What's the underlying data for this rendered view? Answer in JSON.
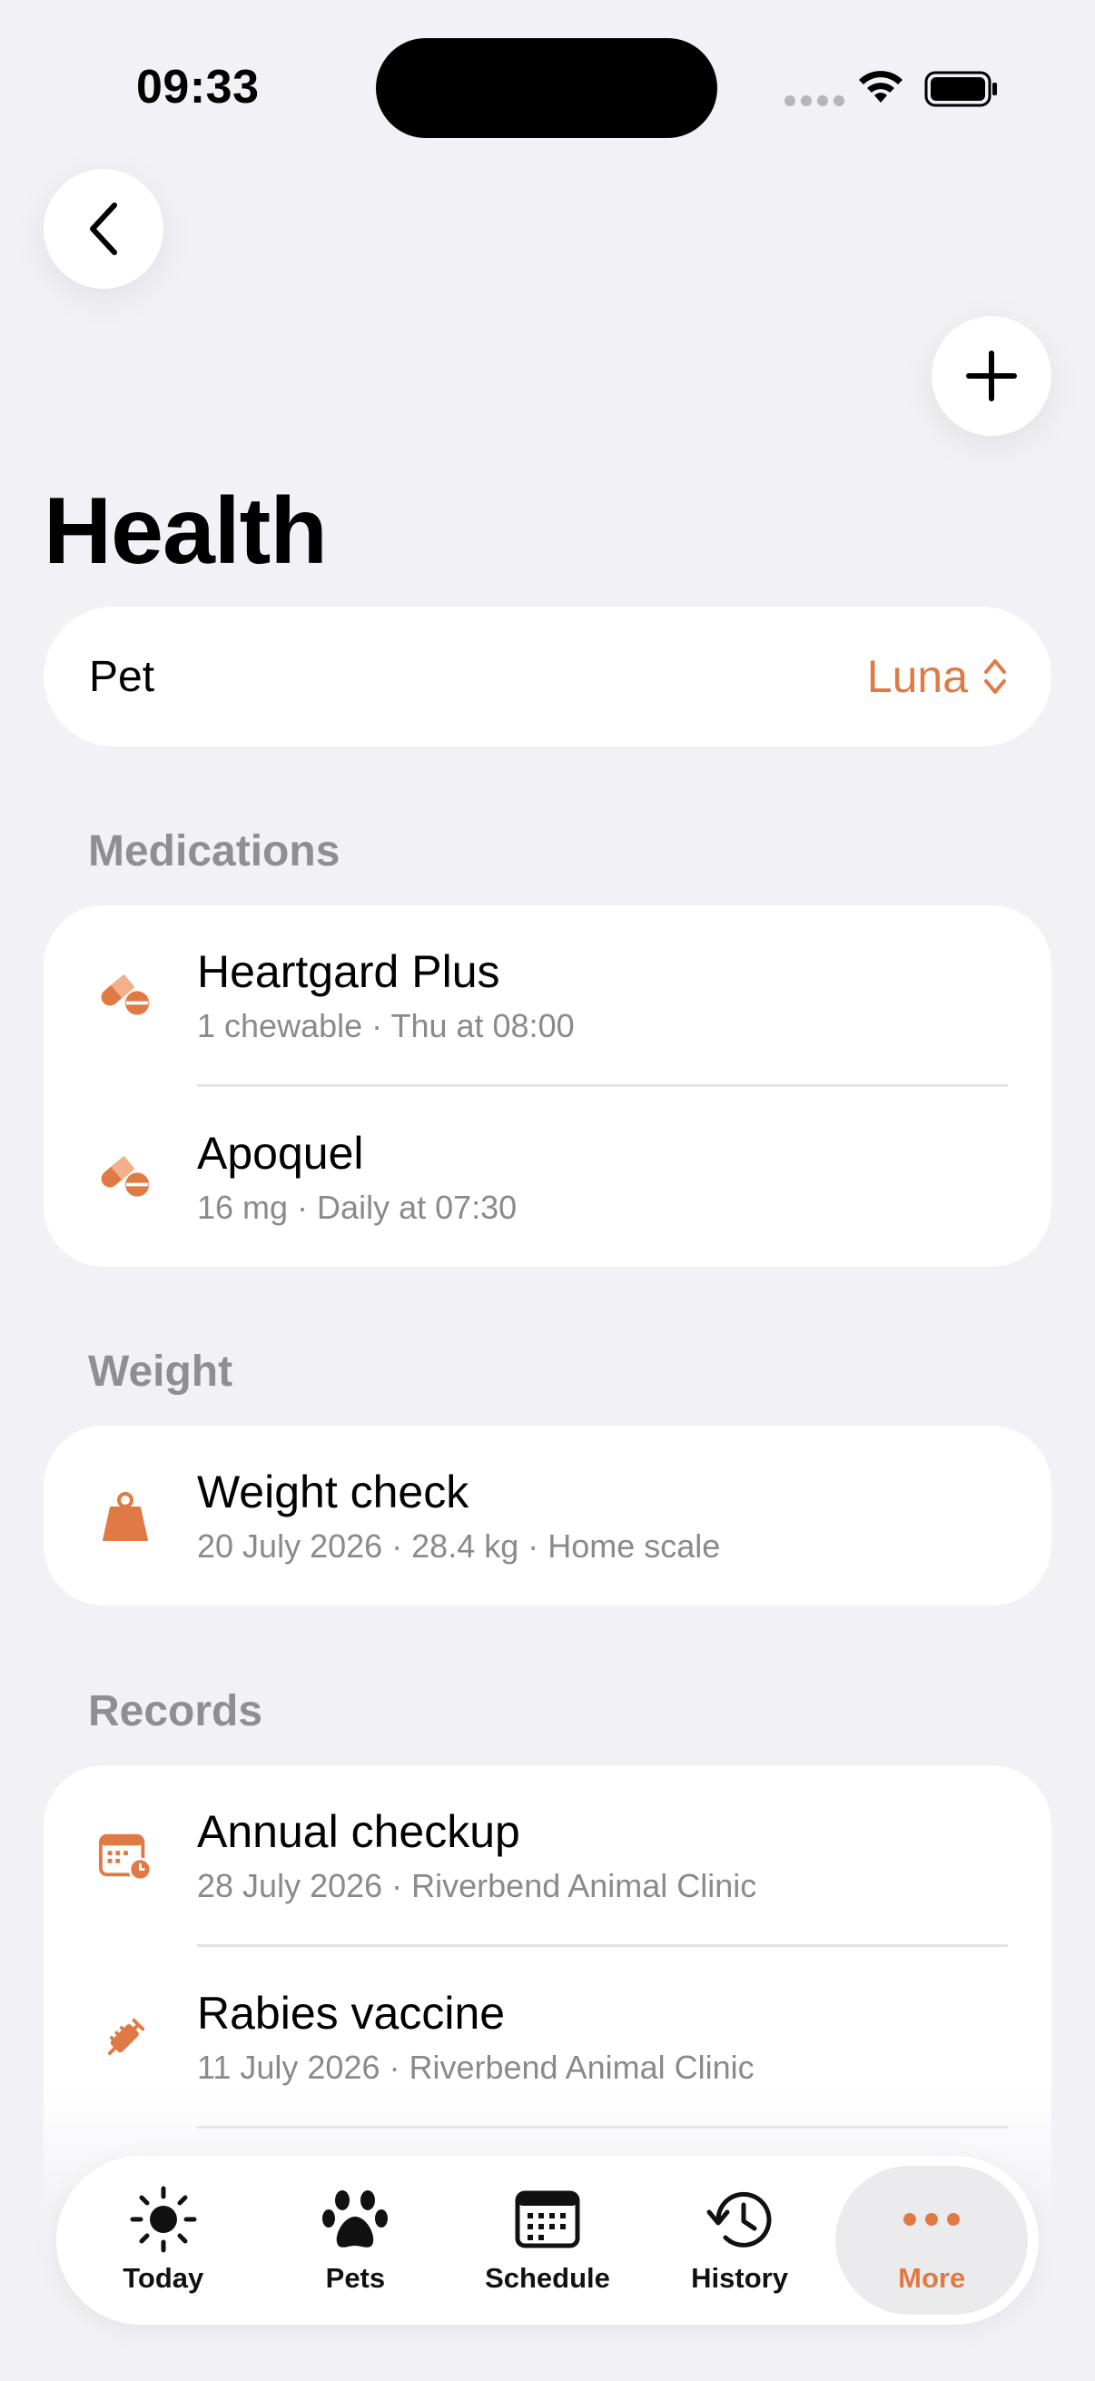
{
  "status_bar": {
    "time": "09:33"
  },
  "page": {
    "title": "Health"
  },
  "pet_selector": {
    "label": "Pet",
    "value": "Luna"
  },
  "sections": {
    "medications": {
      "header": "Medications",
      "items": [
        {
          "title": "Heartgard Plus",
          "subtitle": "1 chewable · Thu at 08:00",
          "icon": "pills-icon"
        },
        {
          "title": "Apoquel",
          "subtitle": "16 mg · Daily at 07:30",
          "icon": "pills-icon"
        }
      ]
    },
    "weight": {
      "header": "Weight",
      "items": [
        {
          "title": "Weight check",
          "subtitle": "20 July 2026 · 28.4 kg · Home scale",
          "icon": "weight-icon"
        }
      ]
    },
    "records": {
      "header": "Records",
      "items": [
        {
          "title": "Annual checkup",
          "subtitle": "28 July 2026 · Riverbend Animal Clinic",
          "icon": "calendar-clock-icon"
        },
        {
          "title": "Rabies vaccine",
          "subtitle": "11 July 2026 · Riverbend Animal Clinic",
          "icon": "syringe-icon"
        }
      ]
    }
  },
  "tabbar": {
    "tabs": [
      {
        "label": "Today",
        "icon": "sun-icon"
      },
      {
        "label": "Pets",
        "icon": "paw-icon"
      },
      {
        "label": "Schedule",
        "icon": "calendar-icon"
      },
      {
        "label": "History",
        "icon": "history-icon"
      },
      {
        "label": "More",
        "icon": "ellipsis-icon",
        "active": true
      }
    ]
  },
  "colors": {
    "accent": "#e07a45",
    "background": "#f1f1f6",
    "secondary_text": "#8a8a8e"
  }
}
